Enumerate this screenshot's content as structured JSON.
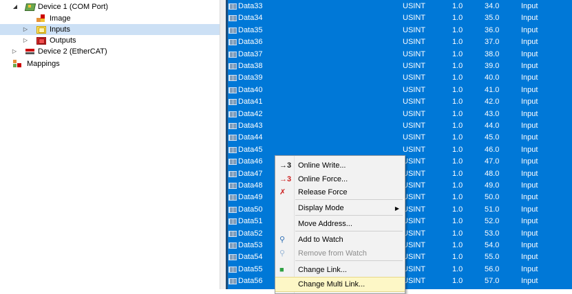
{
  "tree": {
    "nodes": [
      {
        "label": "Device 1 (COM Port)",
        "expander": "◢",
        "icon": "device-icon"
      },
      {
        "label": "Image",
        "expander": "",
        "icon": "image-icon"
      },
      {
        "label": "Inputs",
        "expander": "▷",
        "icon": "inputs-icon",
        "selected": true
      },
      {
        "label": "Outputs",
        "expander": "▷",
        "icon": "outputs-icon"
      },
      {
        "label": "Device 2 (EtherCAT)",
        "expander": "▷",
        "icon": "ethercat-icon"
      },
      {
        "label": "Mappings",
        "expander": "",
        "icon": "mappings-icon"
      }
    ]
  },
  "grid": {
    "rows": [
      {
        "name": "Data33",
        "type": "USINT",
        "size": "1.0",
        "address": "34.0",
        "io": "Input"
      },
      {
        "name": "Data34",
        "type": "USINT",
        "size": "1.0",
        "address": "35.0",
        "io": "Input"
      },
      {
        "name": "Data35",
        "type": "USINT",
        "size": "1.0",
        "address": "36.0",
        "io": "Input"
      },
      {
        "name": "Data36",
        "type": "USINT",
        "size": "1.0",
        "address": "37.0",
        "io": "Input"
      },
      {
        "name": "Data37",
        "type": "USINT",
        "size": "1.0",
        "address": "38.0",
        "io": "Input"
      },
      {
        "name": "Data38",
        "type": "USINT",
        "size": "1.0",
        "address": "39.0",
        "io": "Input"
      },
      {
        "name": "Data39",
        "type": "USINT",
        "size": "1.0",
        "address": "40.0",
        "io": "Input"
      },
      {
        "name": "Data40",
        "type": "USINT",
        "size": "1.0",
        "address": "41.0",
        "io": "Input"
      },
      {
        "name": "Data41",
        "type": "USINT",
        "size": "1.0",
        "address": "42.0",
        "io": "Input"
      },
      {
        "name": "Data42",
        "type": "USINT",
        "size": "1.0",
        "address": "43.0",
        "io": "Input"
      },
      {
        "name": "Data43",
        "type": "USINT",
        "size": "1.0",
        "address": "44.0",
        "io": "Input"
      },
      {
        "name": "Data44",
        "type": "USINT",
        "size": "1.0",
        "address": "45.0",
        "io": "Input"
      },
      {
        "name": "Data45",
        "type": "USINT",
        "size": "1.0",
        "address": "46.0",
        "io": "Input"
      },
      {
        "name": "Data46",
        "type": "USINT",
        "size": "1.0",
        "address": "47.0",
        "io": "Input"
      },
      {
        "name": "Data47",
        "type": "USINT",
        "size": "1.0",
        "address": "48.0",
        "io": "Input"
      },
      {
        "name": "Data48",
        "type": "USINT",
        "size": "1.0",
        "address": "49.0",
        "io": "Input"
      },
      {
        "name": "Data49",
        "type": "USINT",
        "size": "1.0",
        "address": "50.0",
        "io": "Input"
      },
      {
        "name": "Data50",
        "type": "USINT",
        "size": "1.0",
        "address": "51.0",
        "io": "Input"
      },
      {
        "name": "Data51",
        "type": "USINT",
        "size": "1.0",
        "address": "52.0",
        "io": "Input"
      },
      {
        "name": "Data52",
        "type": "USINT",
        "size": "1.0",
        "address": "53.0",
        "io": "Input"
      },
      {
        "name": "Data53",
        "type": "USINT",
        "size": "1.0",
        "address": "54.0",
        "io": "Input"
      },
      {
        "name": "Data54",
        "type": "USINT",
        "size": "1.0",
        "address": "55.0",
        "io": "Input"
      },
      {
        "name": "Data55",
        "type": "USINT",
        "size": "1.0",
        "address": "56.0",
        "io": "Input"
      },
      {
        "name": "Data56",
        "type": "USINT",
        "size": "1.0",
        "address": "57.0",
        "io": "Input"
      }
    ]
  },
  "context_menu": {
    "items": [
      {
        "label": "Online Write...",
        "icon": "online-write-icon",
        "glyph": "→3",
        "icon_color": "#1a1a1a"
      },
      {
        "label": "Online Force...",
        "icon": "online-force-icon",
        "glyph": "→3",
        "icon_color": "#cc1f1f"
      },
      {
        "label": "Release Force",
        "icon": "release-force-icon",
        "glyph": "✗",
        "icon_color": "#cc1f1f"
      },
      {
        "label": "Display Mode",
        "icon": "",
        "glyph": "",
        "submenu": true,
        "arrow": "▶"
      },
      {
        "label": "Move Address...",
        "icon": "",
        "glyph": ""
      },
      {
        "label": "Add to Watch",
        "icon": "add-watch-icon",
        "glyph": "⚲",
        "icon_color": "#2f6fb5"
      },
      {
        "label": "Remove from Watch",
        "icon": "remove-watch-icon",
        "glyph": "⚲",
        "icon_color": "#9bb7d6",
        "disabled": true
      },
      {
        "label": "Change Link...",
        "icon": "change-link-icon",
        "glyph": "■",
        "icon_color": "#2ea043"
      },
      {
        "label": "Change Multi Link...",
        "icon": "",
        "glyph": "",
        "highlighted": true
      }
    ]
  },
  "colors": {
    "selection_bg": "#0078d7",
    "tree_selected": "#cce0f5",
    "menu_highlight": "#fdf7c6"
  }
}
